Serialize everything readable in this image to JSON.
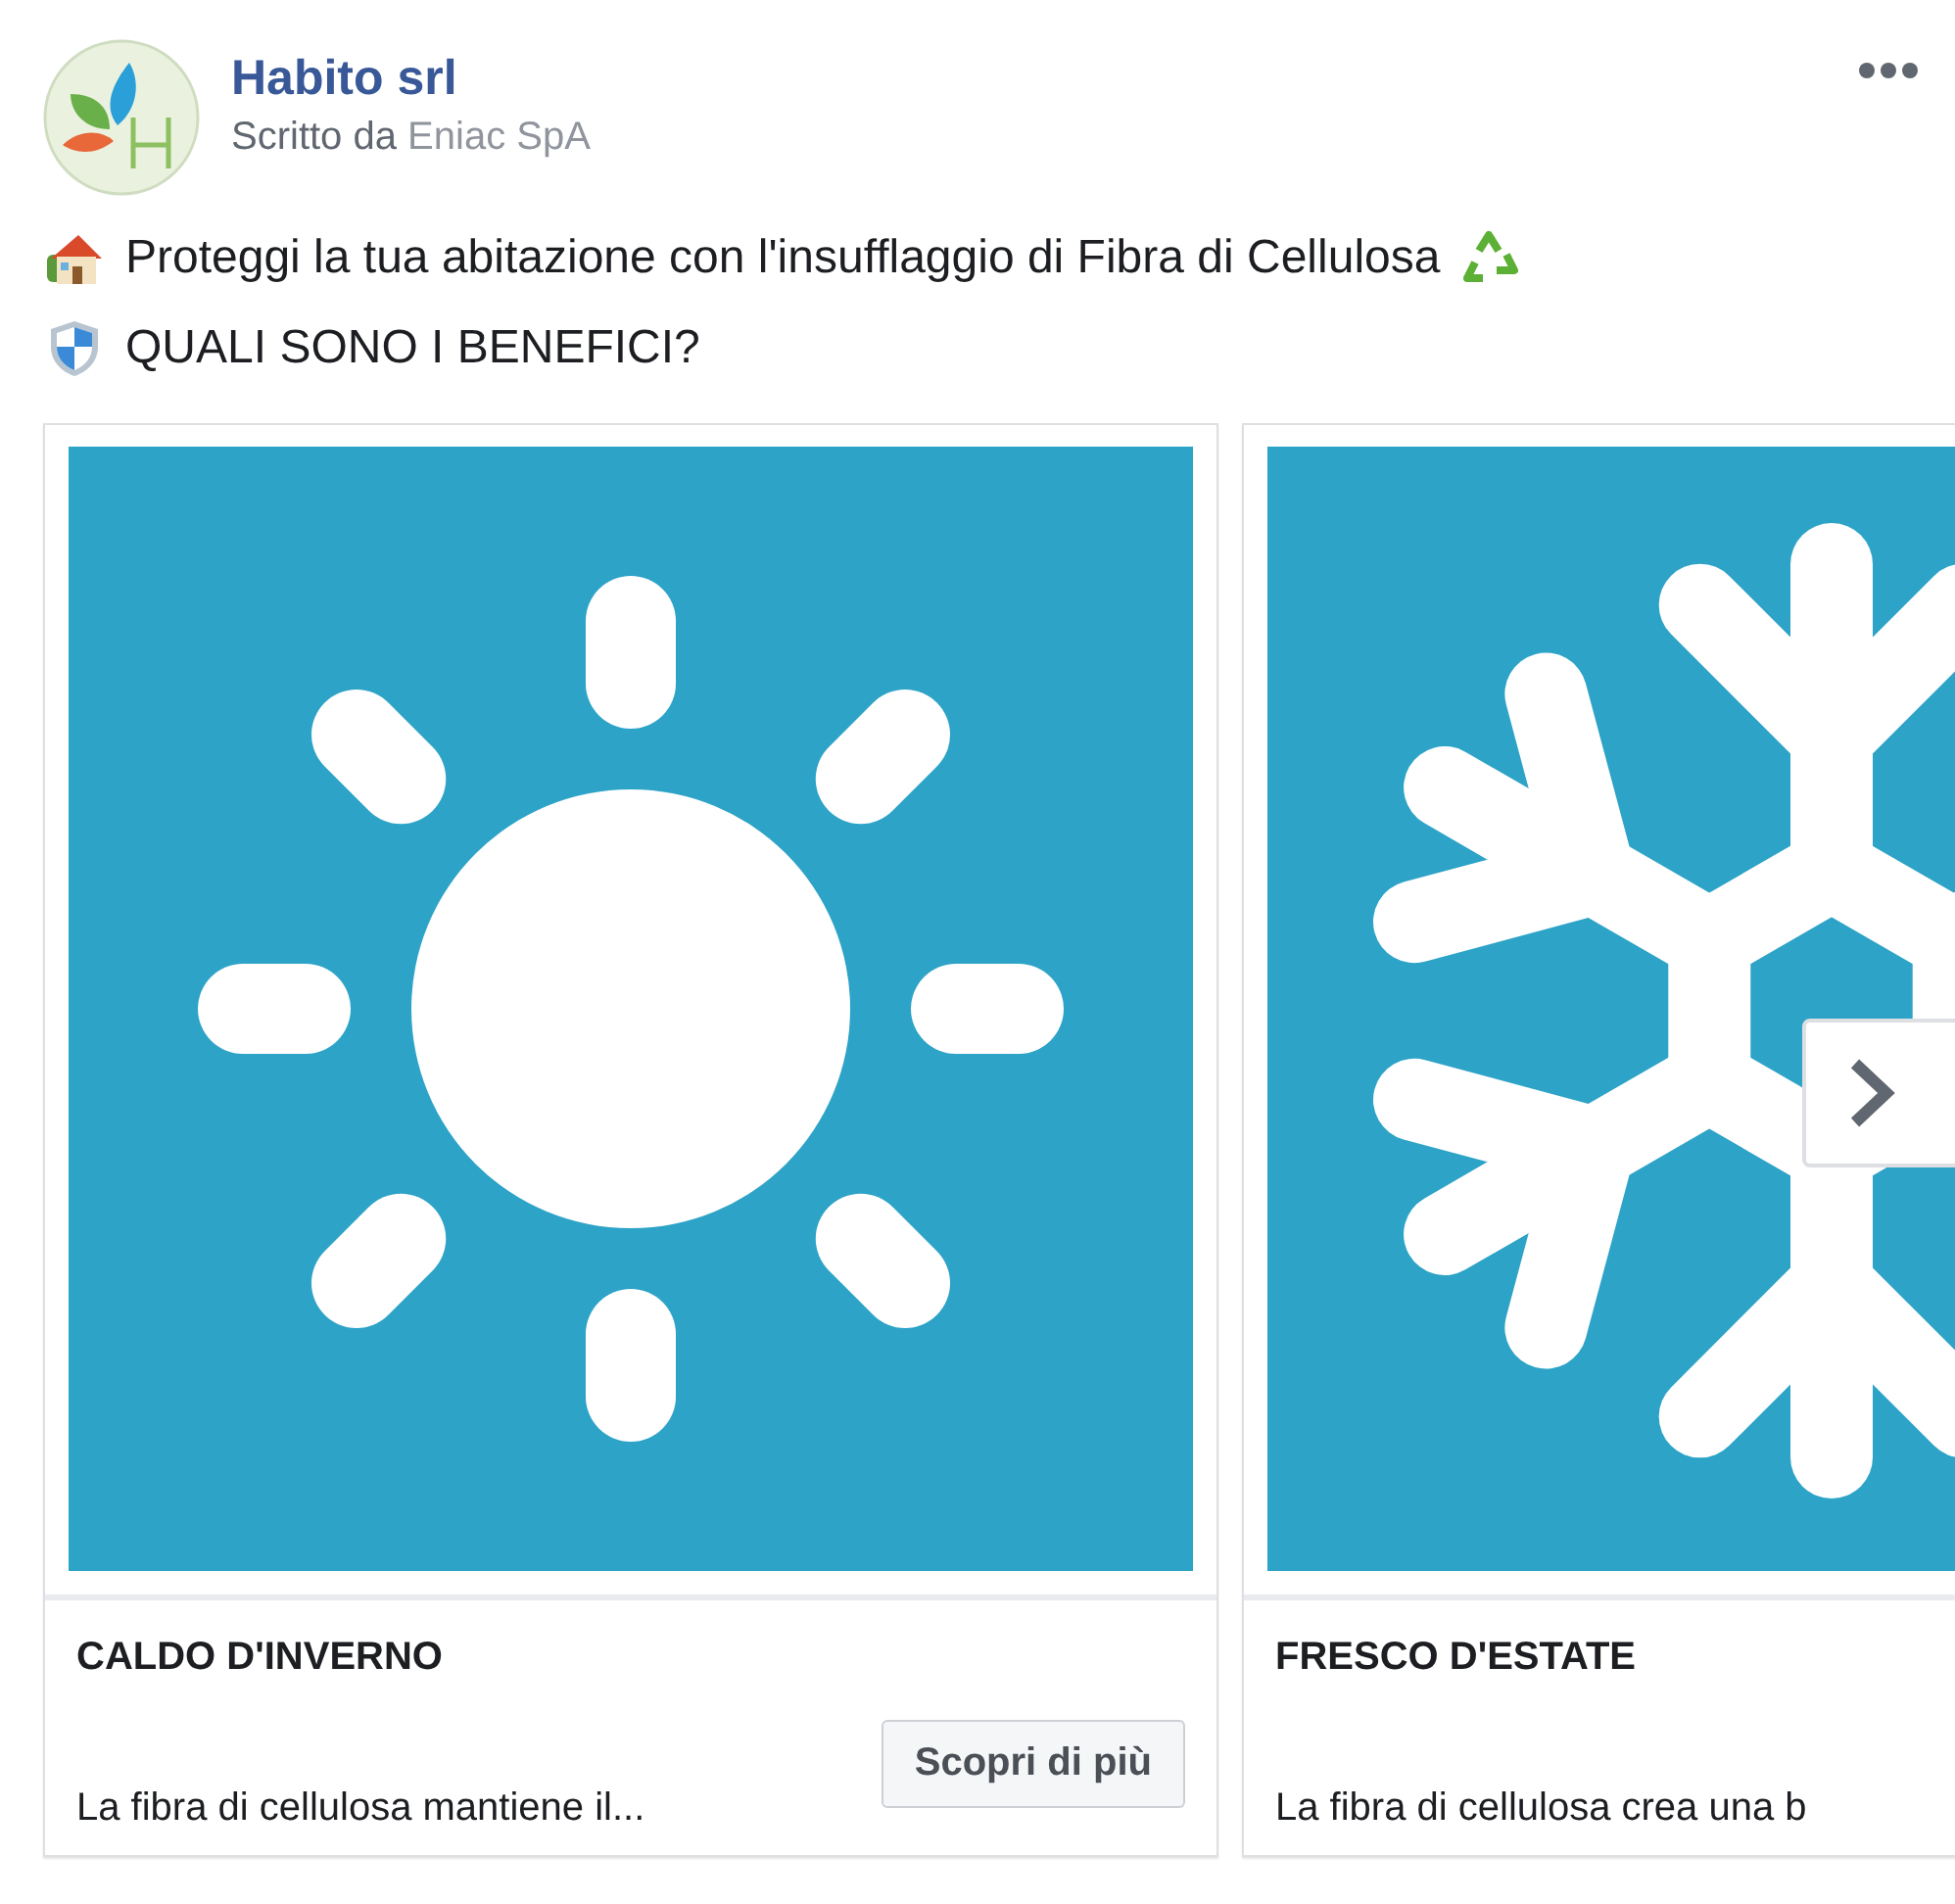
{
  "post": {
    "page_name": "Habito srl",
    "byline": {
      "prefix": "Scritto da",
      "author": "Eniac SpA"
    },
    "lines": [
      "Proteggi la tua abitazione con l'insufflaggio di Fibra di Cellulosa",
      "QUALI SONO I BENEFICI?"
    ]
  },
  "carousel": {
    "cards": [
      {
        "title": "CALDO D'INVERNO",
        "description": "La fibra di cellulosa mantiene il...",
        "button": "Scopri di più"
      },
      {
        "title": "FRESCO D'ESTATE",
        "description": "La fibra di cellulosa crea una b"
      }
    ]
  }
}
